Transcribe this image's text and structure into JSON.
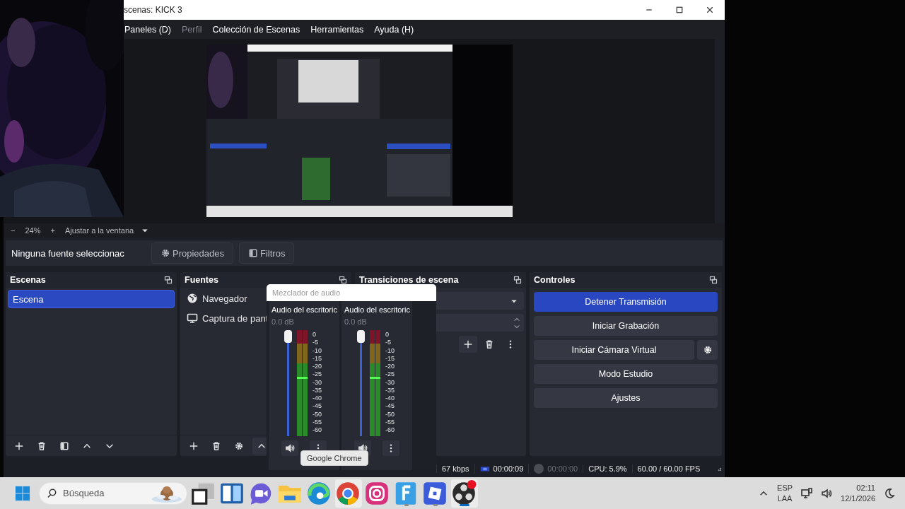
{
  "window": {
    "title": "scenas: KICK 3"
  },
  "menu": [
    {
      "label": "Paneles (D)",
      "disabled": false
    },
    {
      "label": "Perfil",
      "disabled": true
    },
    {
      "label": "Colección de Escenas",
      "disabled": false
    },
    {
      "label": "Herramientas",
      "disabled": false
    },
    {
      "label": "Ayuda (H)",
      "disabled": false
    }
  ],
  "zoom_bar": {
    "minus": "−",
    "zoom": "24%",
    "plus": "+",
    "fit": "Ajustar a la ventana"
  },
  "source_toolbar": {
    "status": "Ninguna fuente seleccionac",
    "buttons": [
      {
        "label": "Propiedades",
        "kind": "gear"
      },
      {
        "label": "Filtros",
        "kind": "filter"
      }
    ]
  },
  "scenes": {
    "title": "Escenas",
    "items": [
      {
        "label": "Escena",
        "selected": true
      }
    ]
  },
  "sources": {
    "title": "Fuentes",
    "items": [
      {
        "label": "Navegador",
        "kind": "globe"
      },
      {
        "label": "Captura de pant",
        "kind": "monitor"
      }
    ]
  },
  "transitions": {
    "title": "Transiciones de escena"
  },
  "controls": {
    "title": "Controles",
    "buttons": [
      {
        "label": "Detener Transmisión",
        "kind": "primary"
      },
      {
        "label": "Iniciar Grabación",
        "kind": "normal"
      },
      {
        "label": "Iniciar Cámara Virtual",
        "kind": "settings"
      },
      {
        "label": "Modo Estudio",
        "kind": "normal"
      },
      {
        "label": "Ajustes",
        "kind": "normal"
      }
    ]
  },
  "mixer": {
    "title": "Mezclador de audio",
    "tooltip": "Google Chrome",
    "channels": [
      {
        "name": "Audio del escritoric",
        "volume": "0.0 dB",
        "level": 1,
        "scale": [
          "0",
          "-5",
          "-10",
          "-15",
          "-20",
          "-25",
          "-30",
          "-35",
          "-40",
          "-45",
          "-50",
          "-55",
          "-60"
        ]
      },
      {
        "name": "Audio del escritoric",
        "volume": "0.0 dB",
        "level": 1,
        "scale": [
          "0",
          "-5",
          "-10",
          "-15",
          "-20",
          "-25",
          "-30",
          "-35",
          "-40",
          "-45",
          "-50",
          "-55",
          "-60"
        ]
      }
    ]
  },
  "status_bar": {
    "bitrate": "67 kbps",
    "stream_time": "00:00:09",
    "record_time": "00:00:00",
    "cpu": "CPU: 5.9%",
    "fps": "60.00 / 60.00 FPS"
  },
  "taskbar": {
    "search_placeholder": "Búsqueda",
    "apps": [
      {
        "kind": "task-view",
        "selected": false,
        "running": false,
        "hovered": false
      },
      {
        "kind": "widgets",
        "selected": false,
        "running": false,
        "hovered": false
      },
      {
        "kind": "meet",
        "selected": false,
        "running": false,
        "hovered": false
      },
      {
        "kind": "files",
        "selected": false,
        "running": false,
        "hovered": false
      },
      {
        "kind": "edge",
        "selected": false,
        "running": false,
        "hovered": false
      },
      {
        "kind": "chrome",
        "selected": false,
        "running": false,
        "hovered": true
      },
      {
        "kind": "instagram",
        "selected": false,
        "running": false,
        "hovered": false
      },
      {
        "kind": "f-app",
        "selected": false,
        "running": true,
        "hovered": false
      },
      {
        "kind": "roblox",
        "selected": false,
        "running": true,
        "hovered": false
      },
      {
        "kind": "obs",
        "selected": true,
        "running": true,
        "hovered": false
      }
    ],
    "tray": {
      "language": "ESP",
      "layout": "LAA",
      "time": "02:11",
      "date": "12/1/2026"
    }
  }
}
